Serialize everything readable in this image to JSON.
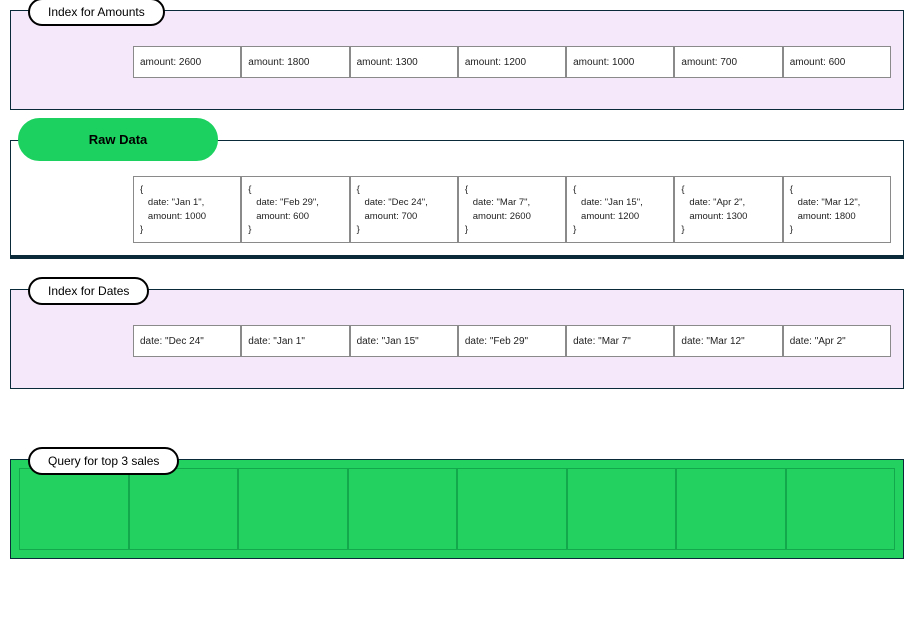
{
  "panels": {
    "index_amounts": {
      "label": "Index for Amounts",
      "cells": [
        "amount: 2600",
        "amount: 1800",
        "amount: 1300",
        "amount: 1200",
        "amount: 1000",
        "amount: 700",
        "amount: 600"
      ]
    },
    "raw_data": {
      "label": "Raw Data",
      "records": [
        {
          "date": "\"Jan 1\"",
          "amount": "1000"
        },
        {
          "date": "\"Feb 29\"",
          "amount": "600"
        },
        {
          "date": "\"Dec 24\"",
          "amount": "700"
        },
        {
          "date": "\"Mar 7\"",
          "amount": "2600"
        },
        {
          "date": "\"Jan 15\"",
          "amount": "1200"
        },
        {
          "date": "\"Apr 2\"",
          "amount": "1300"
        },
        {
          "date": "\"Mar 12\"",
          "amount": "1800"
        }
      ]
    },
    "index_dates": {
      "label": "Index for Dates",
      "cells": [
        "date: \"Dec 24\"",
        "date: \"Jan 1\"",
        "date: \"Jan 15\"",
        "date: \"Feb 29\"",
        "date: \"Mar 7\"",
        "date: \"Mar 12\"",
        "date: \"Apr 2\""
      ]
    },
    "query": {
      "label": "Query for top 3 sales",
      "cell_count": 8
    }
  }
}
